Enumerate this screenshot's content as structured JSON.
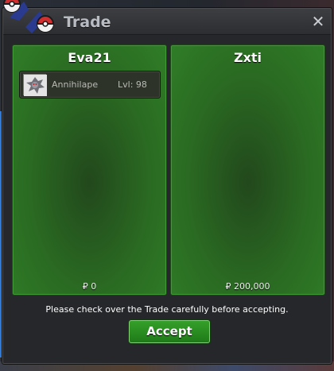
{
  "window": {
    "title": "Trade",
    "close_label": "✕"
  },
  "traders": [
    {
      "name": "Eva21",
      "money": "₽ 0",
      "items": [
        {
          "pokemon": "Annihilape",
          "level": "Lvl: 98",
          "icon": "annihilape-sprite-icon"
        }
      ]
    },
    {
      "name": "Zxti",
      "money": "₽ 200,000",
      "items": []
    }
  ],
  "notice": "Please check over the Trade carefully before accepting.",
  "accept_label": "Accept",
  "colors": {
    "panel_green": "#2a6a22",
    "button_green": "#2e9124",
    "window_bg": "#25272a"
  }
}
